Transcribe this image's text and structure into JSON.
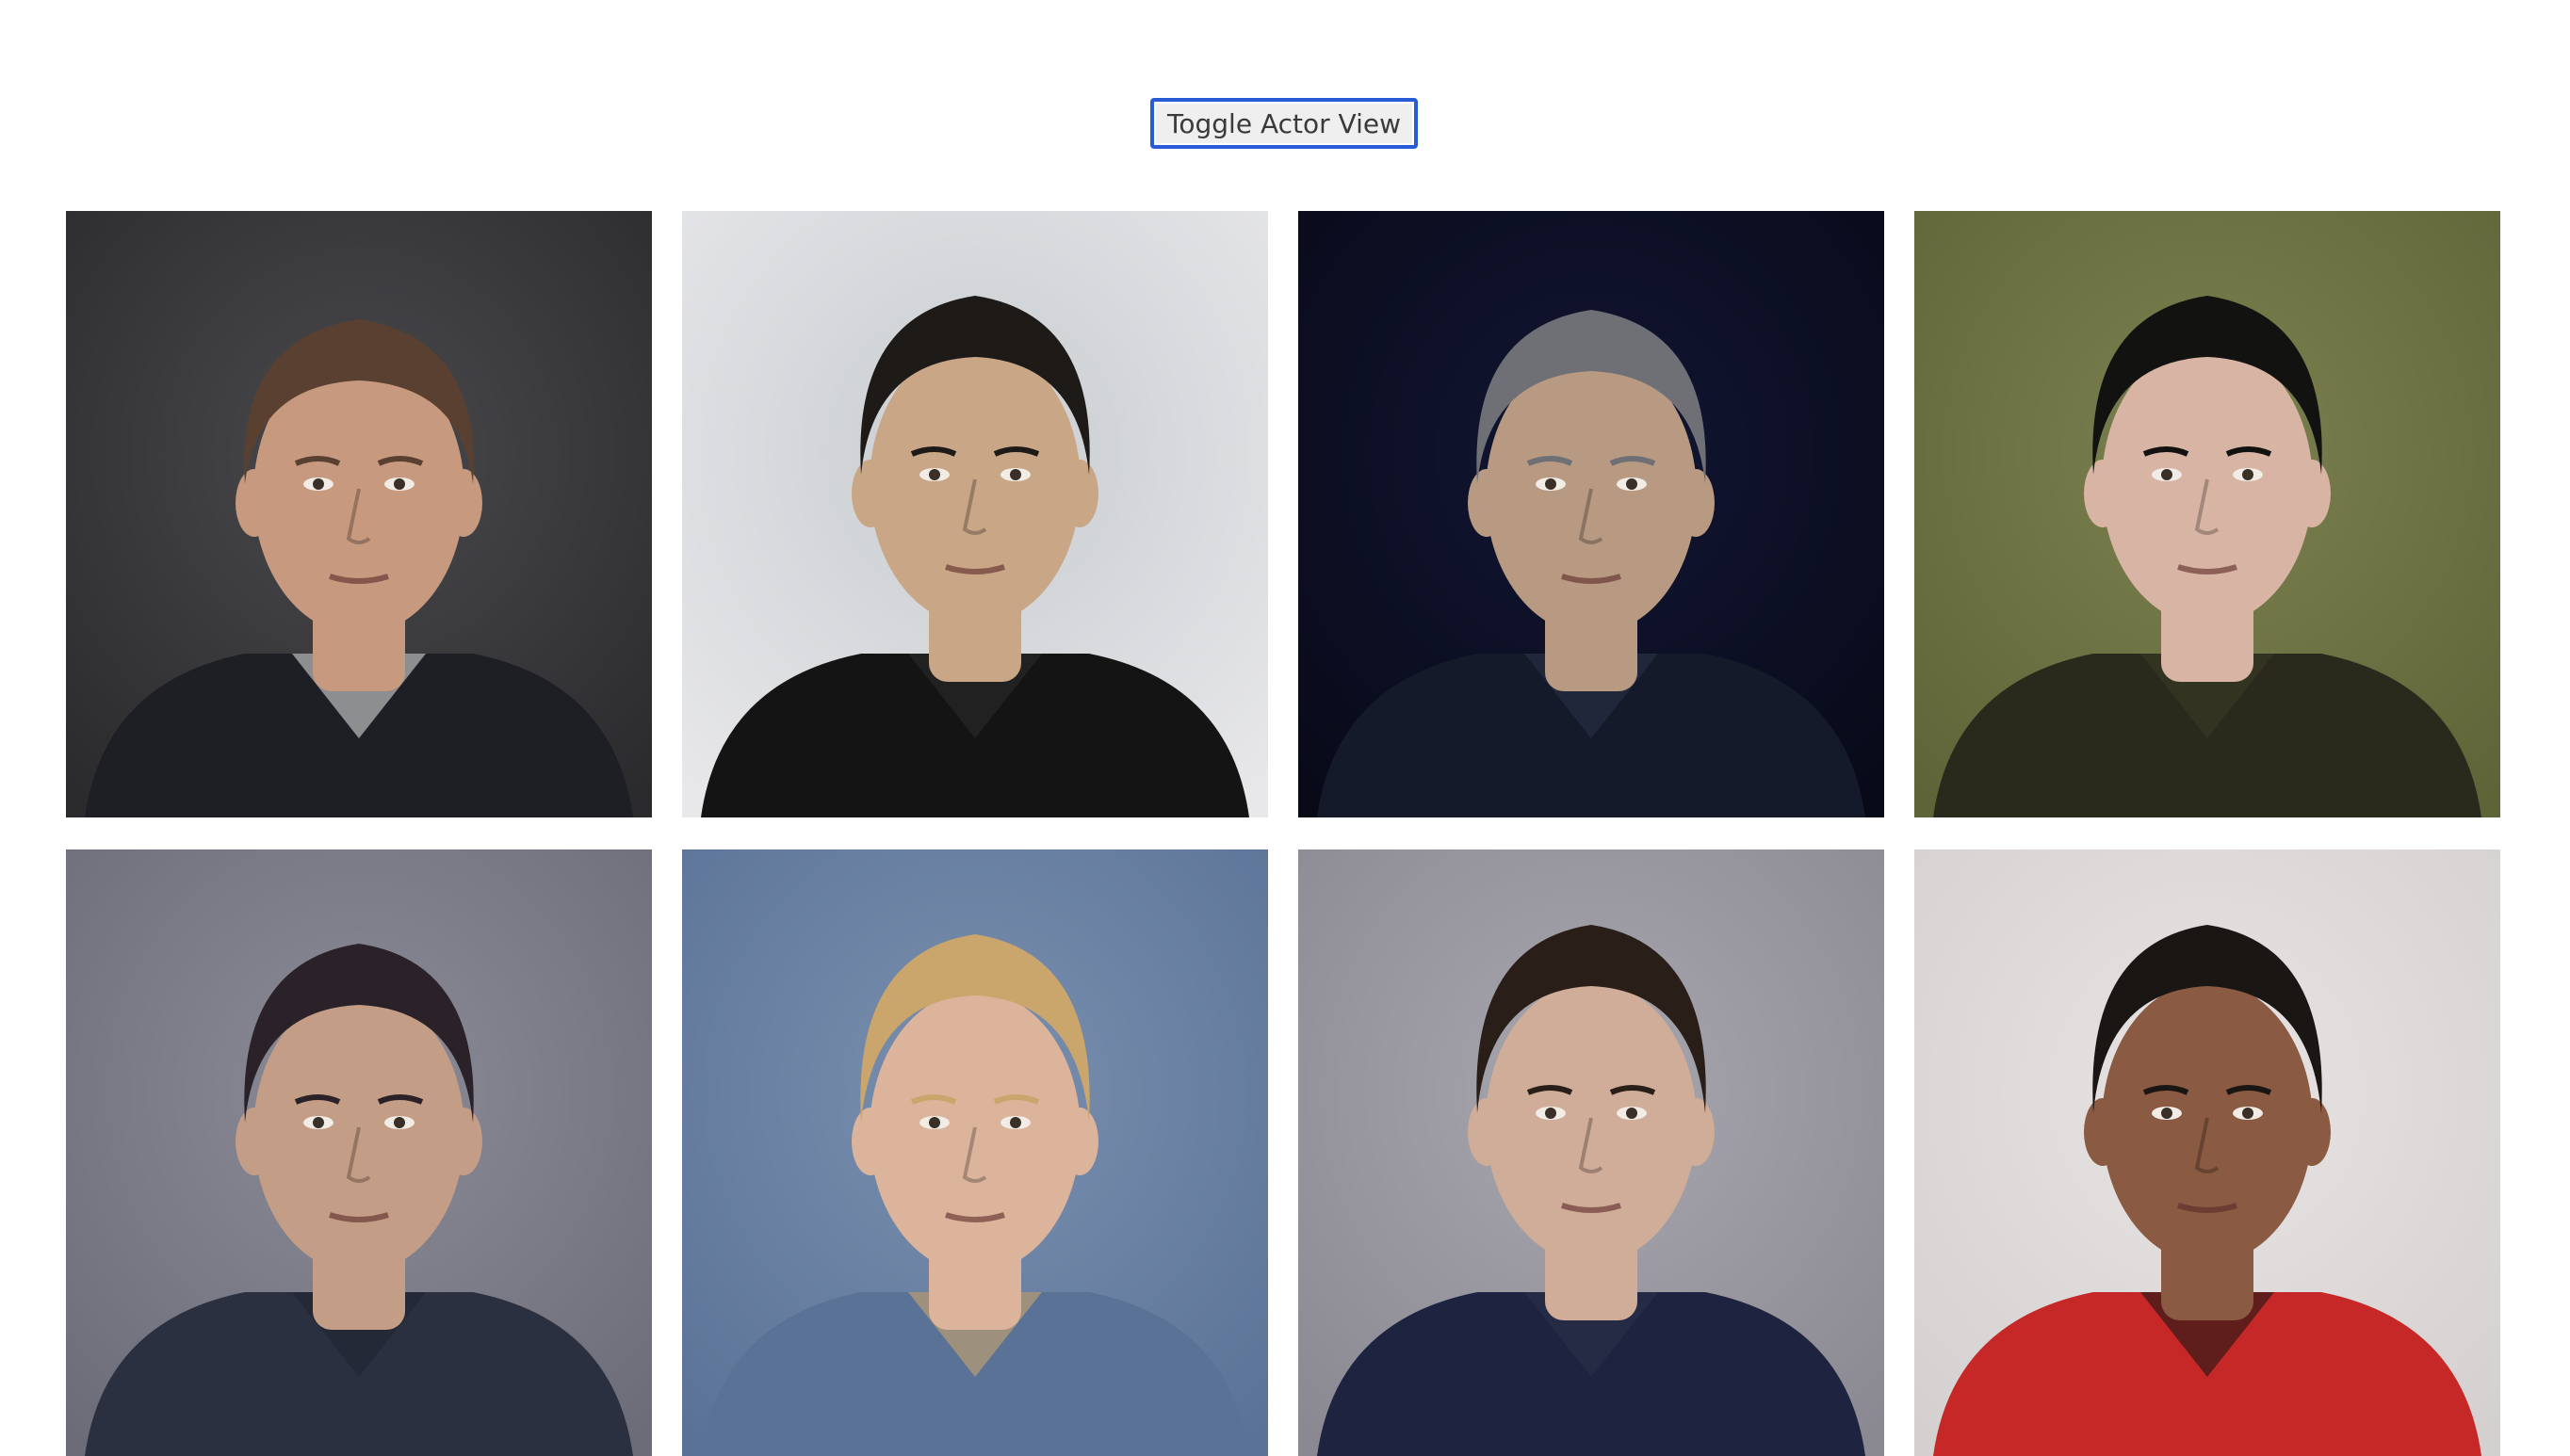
{
  "toolbar": {
    "toggle_label": "Toggle Actor View"
  },
  "actors": [
    {
      "bg": "#2a2a2c",
      "bg2": "#4a4a4e",
      "skin": "#c79a80",
      "hair": "#5a4030",
      "shirt": "#1d1f24",
      "accent": "#d8d8d8"
    },
    {
      "bg": "#e8e8ea",
      "bg2": "#c8ccd0",
      "skin": "#c9a686",
      "hair": "#1e1a18",
      "shirt": "#141414",
      "accent": "#2a2a2a"
    },
    {
      "bg": "#080a18",
      "bg2": "#121633",
      "skin": "#b89a82",
      "hair": "#6f7076",
      "shirt": "#151a2a",
      "accent": "#2a3048"
    },
    {
      "bg": "#5f6438",
      "bg2": "#7c8150",
      "skin": "#d8b4a4",
      "hair": "#121210",
      "shirt": "#2a2a1c",
      "accent": "#3a3a26"
    },
    {
      "bg": "#6c6c78",
      "bg2": "#8c8c98",
      "skin": "#c49d86",
      "hair": "#2a2228",
      "shirt": "#2a3040",
      "accent": "#1f2430"
    },
    {
      "bg": "#5a7296",
      "bg2": "#7a90b0",
      "skin": "#dcb49c",
      "hair": "#caa56c",
      "shirt": "#5a7296",
      "accent": "#caa56c"
    },
    {
      "bg": "#8a8890",
      "bg2": "#a8a6ae",
      "skin": "#d0ad98",
      "hair": "#2a1e18",
      "shirt": "#1e2440",
      "accent": "#2a2f4a"
    },
    {
      "bg": "#d4d0d0",
      "bg2": "#e8e4e4",
      "skin": "#8a5a42",
      "hair": "#1a1614",
      "shirt": "#c62828",
      "accent": "#1a1614"
    }
  ]
}
